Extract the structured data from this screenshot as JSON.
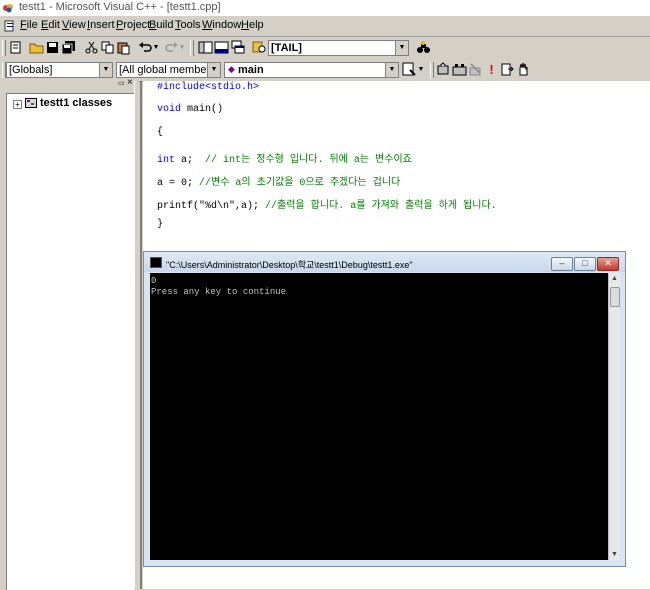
{
  "window": {
    "title": "testt1 - Microsoft Visual C++ - [testt1.cpp]"
  },
  "menu": [
    {
      "underline": "F",
      "rest": "ile"
    },
    {
      "underline": "E",
      "rest": "dit"
    },
    {
      "underline": "V",
      "rest": "iew"
    },
    {
      "underline": "I",
      "rest": "nsert"
    },
    {
      "underline": "P",
      "rest": "roject"
    },
    {
      "underline": "B",
      "rest": "uild"
    },
    {
      "underline": "T",
      "rest": "ools"
    },
    {
      "underline": "W",
      "rest": "indow"
    },
    {
      "underline": "H",
      "rest": "elp"
    }
  ],
  "toolbar": {
    "find_combo_value": "[TAIL]"
  },
  "wizardbar": {
    "class_combo": "[Globals]",
    "filter_combo": "[All global members",
    "members_combo": "main"
  },
  "workspace": {
    "close_glyph": "×",
    "tree_root": "testt1 classes"
  },
  "code": {
    "line1_pre": "#include<stdio.h>",
    "line2_kw": "void",
    "line2_rest": " main()",
    "line3": "{",
    "line4_kw": "int",
    "line4_code": " a;  ",
    "line4_comment": "// int는 정수형 입니다. 뒤에 a는 변수이죠",
    "line5_code": "a = 0; ",
    "line5_comment": "//변수 a의 초기값을 0으로 주겠다는 겁니다",
    "line6_code": "printf(\"%d\\n\",a); ",
    "line6_comment": "//출력을 합니다. a를 가져와 출력을 하게 됩니다.",
    "line7": "}"
  },
  "console": {
    "title": "\"C:\\Users\\Administrator\\Desktop\\학교\\testt1\\Debug\\testt1.exe\"",
    "output_line1": "0",
    "output_line2": "Press any key to continue"
  }
}
